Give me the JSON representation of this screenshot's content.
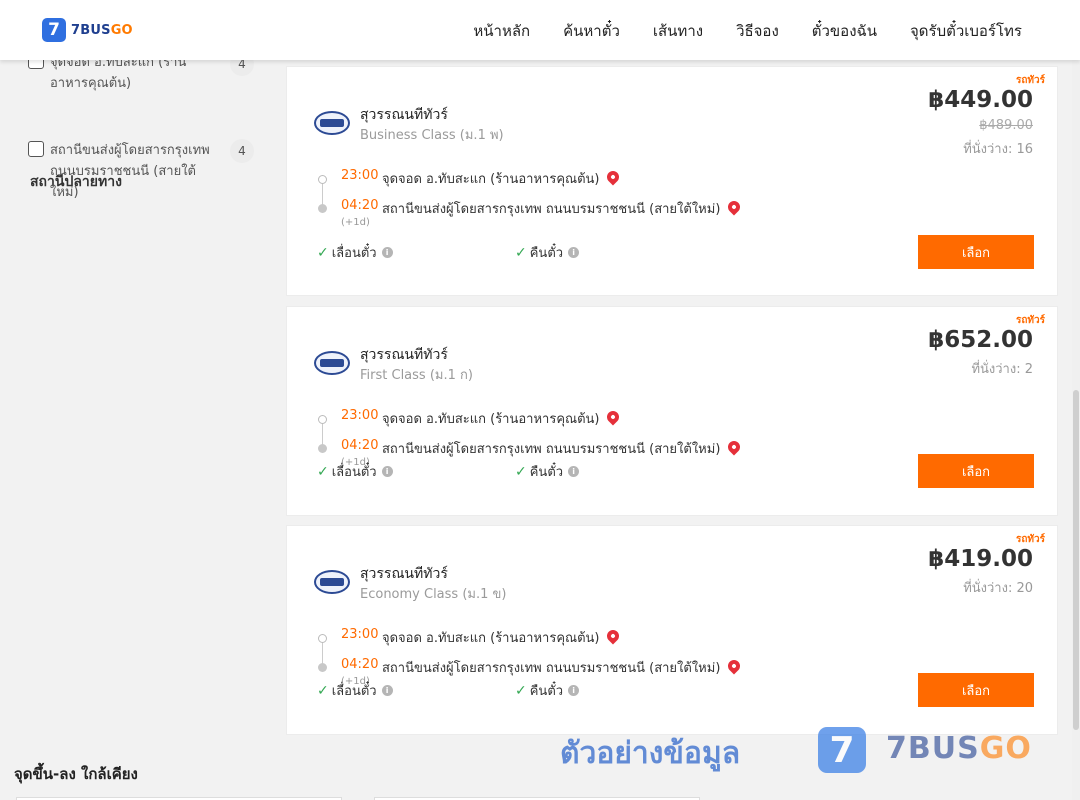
{
  "brand": {
    "logo_mark": "7",
    "logo_7bus": "7BUS",
    "logo_go": "GO"
  },
  "nav": [
    "หน้าหลัก",
    "ค้นหาตั๋ว",
    "เส้นทาง",
    "วิธีจอง",
    "ตั๋วของฉัน",
    "จุดรับตั๋วเบอร์โทร"
  ],
  "sidebar": {
    "top_item": {
      "label": "จุดจอด อ.ทับสะแก (ร้านอาหารคุณต้น)",
      "count": "4"
    },
    "destination_title": "สถานีปลายทาง",
    "destination_item": {
      "label": "สถานีขนส่งผู้โดยสารกรุงเทพ ถนนบรมราชชนนี (สายใต้ใหม่)",
      "count": "4"
    }
  },
  "trips": [
    {
      "tag": "รถทัวร์",
      "operator": "สุวรรณนทีทัวร์",
      "bus_class": "Business Class (ม.1 พ)",
      "price": "฿449.00",
      "old_price": "฿489.00",
      "seats": "ที่นั่งว่าง: 16",
      "dep_time": "23:00",
      "dep_place": "จุดจอด อ.ทับสะแก (ร้านอาหารคุณต้น)",
      "arr_time": "04:20",
      "arr_place": "สถานีขนส่งผู้โดยสารกรุงเทพ ถนนบรมราชชนนี (สายใต้ใหม่)",
      "next_day": "(+1d)",
      "feature1": "เลื่อนตั๋ว",
      "feature2": "คืนตั๋ว",
      "select": "เลือก"
    },
    {
      "tag": "รถทัวร์",
      "operator": "สุวรรณนทีทัวร์",
      "bus_class": "First Class (ม.1 ก)",
      "price": "฿652.00",
      "seats": "ที่นั่งว่าง: 2",
      "dep_time": "23:00",
      "dep_place": "จุดจอด อ.ทับสะแก (ร้านอาหารคุณต้น)",
      "arr_time": "04:20",
      "arr_place": "สถานีขนส่งผู้โดยสารกรุงเทพ ถนนบรมราชชนนี (สายใต้ใหม่)",
      "next_day": "(+1d)",
      "feature1": "เลื่อนตั๋ว",
      "feature2": "คืนตั๋ว",
      "select": "เลือก"
    },
    {
      "tag": "รถทัวร์",
      "operator": "สุวรรณนทีทัวร์",
      "bus_class": "Economy Class (ม.1 ข)",
      "price": "฿419.00",
      "seats": "ที่นั่งว่าง: 20",
      "dep_time": "23:00",
      "dep_place": "จุดจอด อ.ทับสะแก (ร้านอาหารคุณต้น)",
      "arr_time": "04:20",
      "arr_place": "สถานีขนส่งผู้โดยสารกรุงเทพ ถนนบรมราชชนนี (สายใต้ใหม่)",
      "next_day": "(+1d)",
      "feature1": "เลื่อนตั๋ว",
      "feature2": "คืนตั๋ว",
      "select": "เลือก"
    }
  ],
  "watermark": {
    "text": "ตัวอย่างข้อมูล",
    "logo_mark": "7",
    "brand_7bus": "7BUS",
    "brand_go": "GO"
  },
  "nearby": {
    "title": "จุดขึ้น-ลง ใกล้เคียง"
  },
  "icons": {
    "check": "check-icon",
    "info": "info-icon",
    "pin": "map-pin-icon",
    "operator_logo": "operator-logo"
  },
  "colors": {
    "accent": "#ff6a00",
    "brand_blue": "#2f6fe0",
    "pin": "#e5303a",
    "check": "#34a853"
  }
}
